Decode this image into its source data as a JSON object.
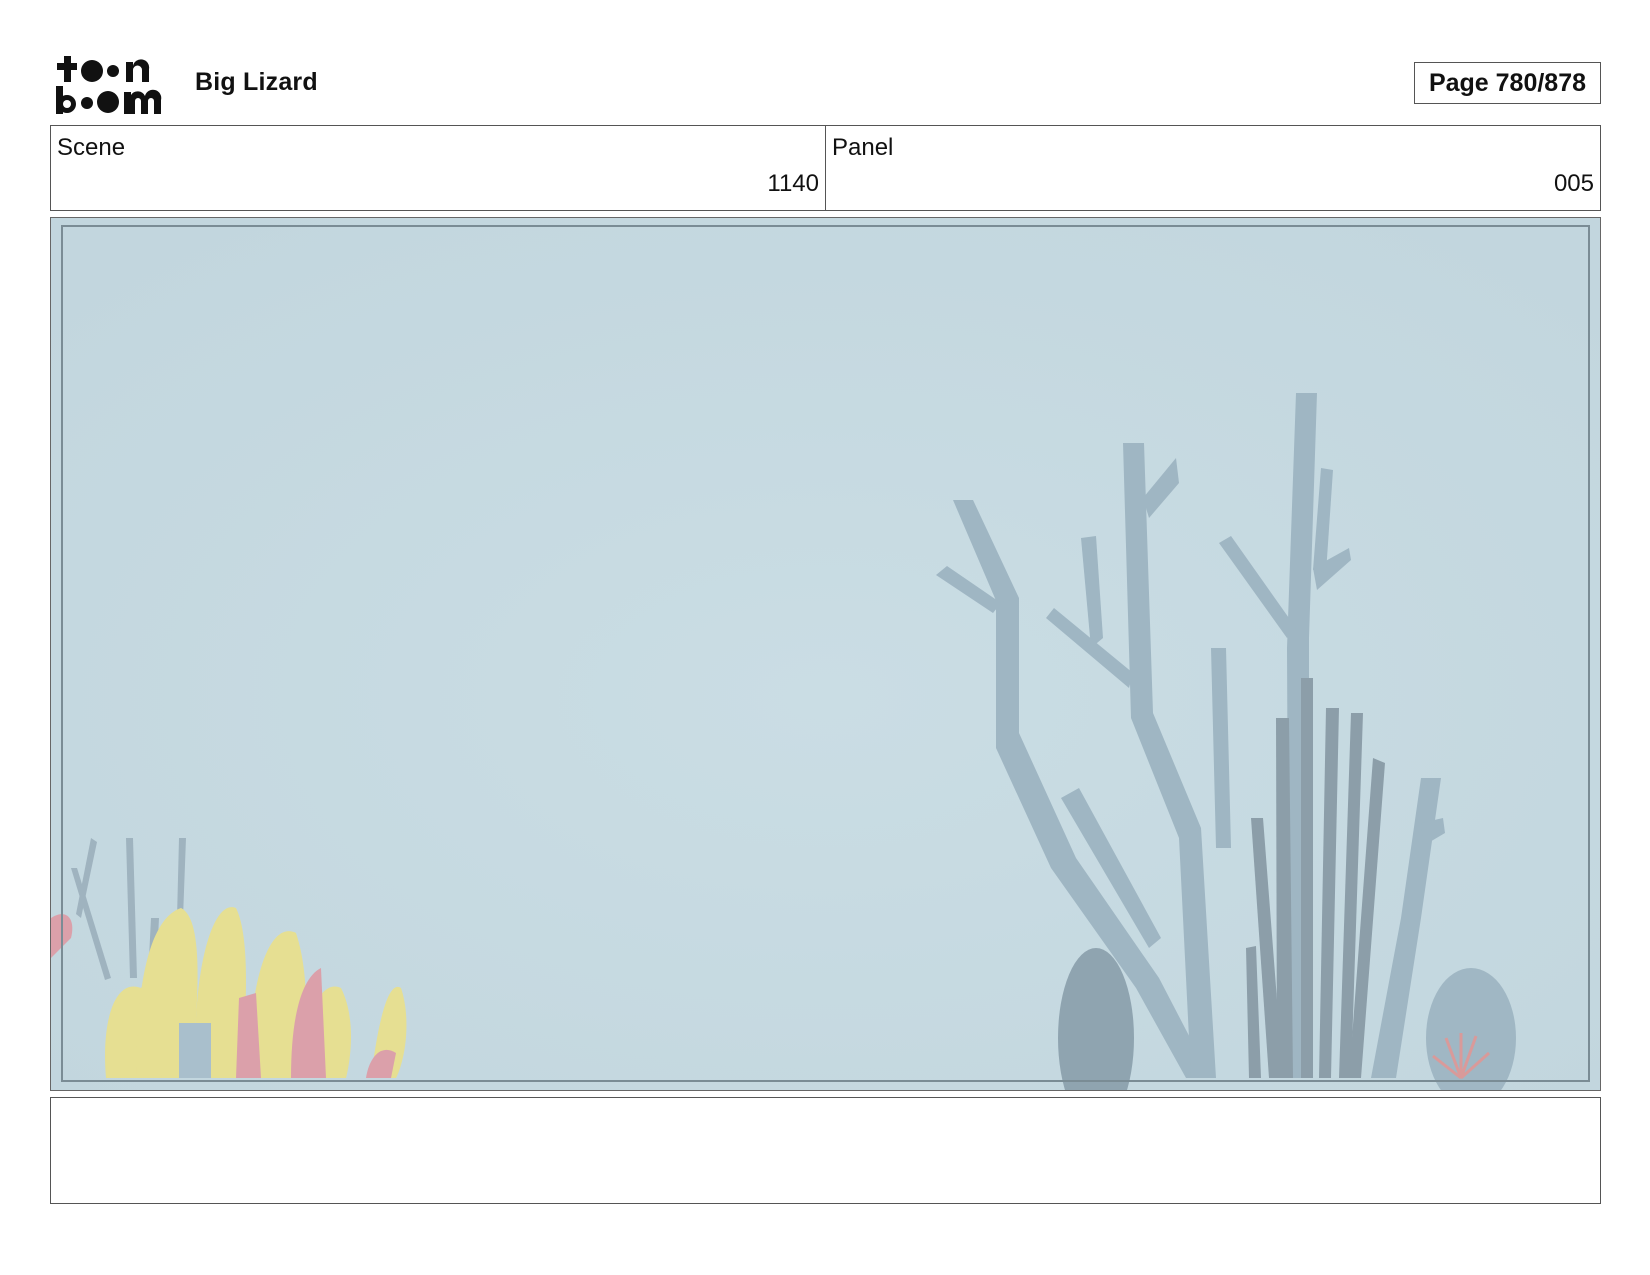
{
  "header": {
    "logo_text": "toon boom",
    "project_title": "Big Lizard",
    "page_label": "Page 780/878"
  },
  "fields": {
    "scene_label": "Scene",
    "scene_value": "1140",
    "panel_label": "Panel",
    "panel_value": "005"
  },
  "panel_image": {
    "background_color": "#c7dae1",
    "coral_color": "#9fb6c3",
    "yellow_coral_color": "#e6df92",
    "pink_coral_color": "#dba0aa"
  },
  "notes": {
    "text": ""
  }
}
